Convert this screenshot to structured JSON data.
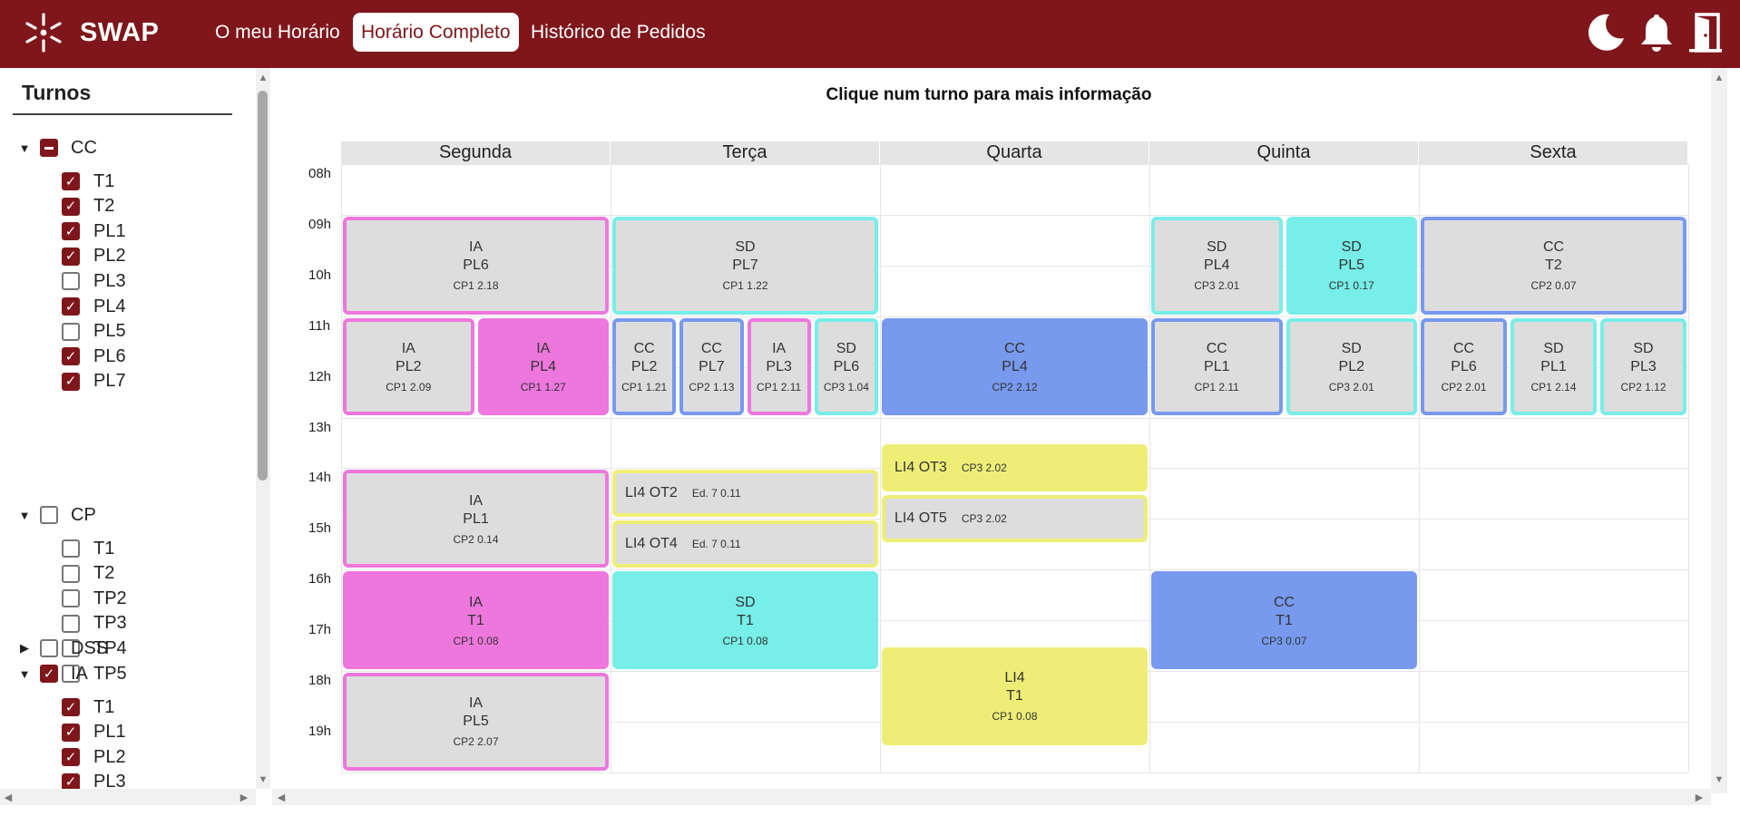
{
  "app": {
    "name": "SWAP",
    "accent": "#7f161b"
  },
  "nav": [
    {
      "label": "O meu Horário",
      "active": false
    },
    {
      "label": "Horário Completo",
      "active": true
    },
    {
      "label": "Histórico de Pedidos",
      "active": false
    }
  ],
  "top_icons": [
    "moon-icon",
    "bell-icon",
    "door-exit-icon"
  ],
  "sidebar": {
    "title": "Turnos",
    "groups": [
      {
        "name": "CC",
        "expanded": true,
        "state": "mixed",
        "items": [
          {
            "label": "T1",
            "checked": true
          },
          {
            "label": "T2",
            "checked": true
          },
          {
            "label": "PL1",
            "checked": true
          },
          {
            "label": "PL2",
            "checked": true
          },
          {
            "label": "PL3",
            "checked": false
          },
          {
            "label": "PL4",
            "checked": true
          },
          {
            "label": "PL5",
            "checked": false
          },
          {
            "label": "PL6",
            "checked": true
          },
          {
            "label": "PL7",
            "checked": true
          }
        ]
      },
      {
        "name": "CP",
        "expanded": true,
        "state": "off",
        "items": [
          {
            "label": "T1",
            "checked": false
          },
          {
            "label": "T2",
            "checked": false
          },
          {
            "label": "TP2",
            "checked": false
          },
          {
            "label": "TP3",
            "checked": false
          },
          {
            "label": "TP4",
            "checked": false
          },
          {
            "label": "TP5",
            "checked": false
          }
        ]
      },
      {
        "name": "DSS",
        "expanded": false,
        "state": "off",
        "items": []
      },
      {
        "name": "IA",
        "expanded": true,
        "state": "on",
        "items": [
          {
            "label": "T1",
            "checked": true
          },
          {
            "label": "PL1",
            "checked": true
          },
          {
            "label": "PL2",
            "checked": true
          },
          {
            "label": "PL3",
            "checked": true
          }
        ]
      }
    ]
  },
  "schedule": {
    "title": "Clique num turno para mais informação",
    "days": [
      "Segunda",
      "Terça",
      "Quarta",
      "Quinta",
      "Sexta"
    ],
    "hours": [
      "08h",
      "09h",
      "10h",
      "11h",
      "12h",
      "13h",
      "14h",
      "15h",
      "16h",
      "17h",
      "18h",
      "19h"
    ],
    "colors": {
      "CC": "#7799ee",
      "IA": "#ee77dd",
      "SD": "#77eee8",
      "LI4": "#eeee77",
      "unselected": "#dddddd"
    },
    "slots": [
      {
        "day": 0,
        "start": 9,
        "end": 11,
        "lane": 0,
        "lanes": 1,
        "subject": "IA",
        "shift": "PL6",
        "room": "CP1 2.18",
        "filled": false
      },
      {
        "day": 0,
        "start": 11,
        "end": 13,
        "lane": 0,
        "lanes": 2,
        "subject": "IA",
        "shift": "PL2",
        "room": "CP1 2.09",
        "filled": false
      },
      {
        "day": 0,
        "start": 11,
        "end": 13,
        "lane": 1,
        "lanes": 2,
        "subject": "IA",
        "shift": "PL4",
        "room": "CP1 1.27",
        "filled": true
      },
      {
        "day": 0,
        "start": 14,
        "end": 16,
        "lane": 0,
        "lanes": 1,
        "subject": "IA",
        "shift": "PL1",
        "room": "CP2 0.14",
        "filled": false
      },
      {
        "day": 0,
        "start": 16,
        "end": 18,
        "lane": 0,
        "lanes": 1,
        "subject": "IA",
        "shift": "T1",
        "room": "CP1 0.08",
        "filled": true
      },
      {
        "day": 0,
        "start": 18,
        "end": 20,
        "lane": 0,
        "lanes": 1,
        "subject": "IA",
        "shift": "PL5",
        "room": "CP2 2.07",
        "filled": false
      },
      {
        "day": 1,
        "start": 9,
        "end": 11,
        "lane": 0,
        "lanes": 1,
        "subject": "SD",
        "shift": "PL7",
        "room": "CP1 1.22",
        "filled": false
      },
      {
        "day": 1,
        "start": 11,
        "end": 13,
        "lane": 0,
        "lanes": 4,
        "subject": "CC",
        "shift": "PL2",
        "room": "CP1 1.21",
        "filled": false
      },
      {
        "day": 1,
        "start": 11,
        "end": 13,
        "lane": 1,
        "lanes": 4,
        "subject": "CC",
        "shift": "PL7",
        "room": "CP2 1.13",
        "filled": false
      },
      {
        "day": 1,
        "start": 11,
        "end": 13,
        "lane": 2,
        "lanes": 4,
        "subject": "IA",
        "shift": "PL3",
        "room": "CP1 2.11",
        "filled": false
      },
      {
        "day": 1,
        "start": 11,
        "end": 13,
        "lane": 3,
        "lanes": 4,
        "subject": "SD",
        "shift": "PL6",
        "room": "CP3 1.04",
        "filled": false
      },
      {
        "day": 1,
        "start": 14,
        "end": 15,
        "lane": 0,
        "lanes": 1,
        "subject": "LI4",
        "shift": "OT2",
        "room": "Ed. 7 0.11",
        "filled": false,
        "inline": true
      },
      {
        "day": 1,
        "start": 15,
        "end": 16,
        "lane": 0,
        "lanes": 1,
        "subject": "LI4",
        "shift": "OT4",
        "room": "Ed. 7 0.11",
        "filled": false,
        "inline": true
      },
      {
        "day": 1,
        "start": 16,
        "end": 18,
        "lane": 0,
        "lanes": 1,
        "subject": "SD",
        "shift": "T1",
        "room": "CP1 0.08",
        "filled": true
      },
      {
        "day": 2,
        "start": 11,
        "end": 13,
        "lane": 0,
        "lanes": 1,
        "subject": "CC",
        "shift": "PL4",
        "room": "CP2 2.12",
        "filled": true
      },
      {
        "day": 2,
        "start": 13.5,
        "end": 14.5,
        "lane": 0,
        "lanes": 1,
        "subject": "LI4",
        "shift": "OT3",
        "room": "CP3 2.02",
        "filled": true,
        "inline": true
      },
      {
        "day": 2,
        "start": 14.5,
        "end": 15.5,
        "lane": 0,
        "lanes": 1,
        "subject": "LI4",
        "shift": "OT5",
        "room": "CP3 2.02",
        "filled": false,
        "inline": true
      },
      {
        "day": 2,
        "start": 17.5,
        "end": 19.5,
        "lane": 0,
        "lanes": 1,
        "subject": "LI4",
        "shift": "T1",
        "room": "CP1 0.08",
        "filled": true
      },
      {
        "day": 3,
        "start": 9,
        "end": 11,
        "lane": 0,
        "lanes": 2,
        "subject": "SD",
        "shift": "PL4",
        "room": "CP3 2.01",
        "filled": false
      },
      {
        "day": 3,
        "start": 9,
        "end": 11,
        "lane": 1,
        "lanes": 2,
        "subject": "SD",
        "shift": "PL5",
        "room": "CP1 0.17",
        "filled": true
      },
      {
        "day": 3,
        "start": 11,
        "end": 13,
        "lane": 0,
        "lanes": 2,
        "subject": "CC",
        "shift": "PL1",
        "room": "CP1 2.11",
        "filled": false
      },
      {
        "day": 3,
        "start": 11,
        "end": 13,
        "lane": 1,
        "lanes": 2,
        "subject": "SD",
        "shift": "PL2",
        "room": "CP3 2.01",
        "filled": false
      },
      {
        "day": 3,
        "start": 16,
        "end": 18,
        "lane": 0,
        "lanes": 1,
        "subject": "CC",
        "shift": "T1",
        "room": "CP3 0.07",
        "filled": true
      },
      {
        "day": 4,
        "start": 9,
        "end": 11,
        "lane": 0,
        "lanes": 1,
        "subject": "CC",
        "shift": "T2",
        "room": "CP2 0.07",
        "filled": false
      },
      {
        "day": 4,
        "start": 11,
        "end": 13,
        "lane": 0,
        "lanes": 3,
        "subject": "CC",
        "shift": "PL6",
        "room": "CP2 2.01",
        "filled": false
      },
      {
        "day": 4,
        "start": 11,
        "end": 13,
        "lane": 1,
        "lanes": 3,
        "subject": "SD",
        "shift": "PL1",
        "room": "CP1 2.14",
        "filled": false
      },
      {
        "day": 4,
        "start": 11,
        "end": 13,
        "lane": 2,
        "lanes": 3,
        "subject": "SD",
        "shift": "PL3",
        "room": "CP2 1.12",
        "filled": false
      }
    ]
  }
}
